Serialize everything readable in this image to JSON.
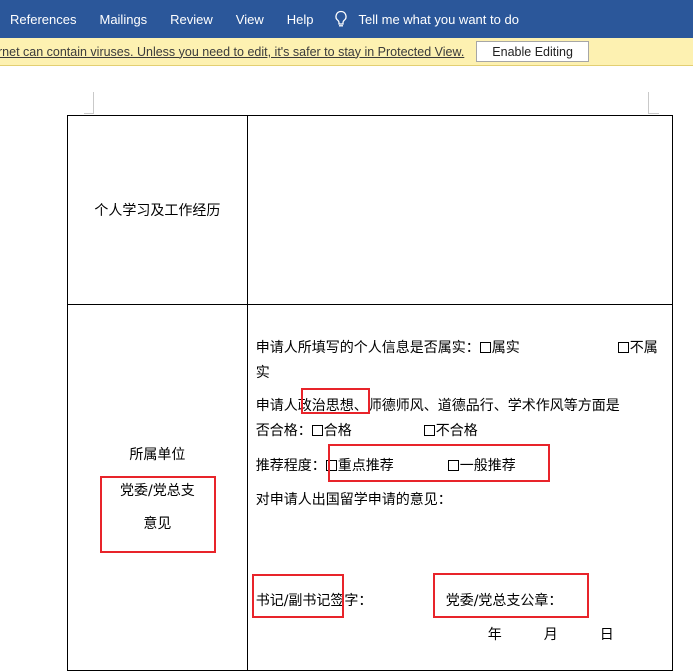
{
  "ribbon": {
    "tabs": [
      "References",
      "Mailings",
      "Review",
      "View",
      "Help"
    ],
    "tell_me": "Tell me what you want to do"
  },
  "protected_view": {
    "message": "rnet can contain viruses. Unless you need to edit, it's safer to stay in Protected View.",
    "button": "Enable Editing"
  },
  "form": {
    "row1_label": "个人学习及工作经历",
    "row2_label_line1": "所属单位",
    "row2_label_line2": "党委/党总支",
    "row2_label_line3": "意见",
    "info_question_a": "申请人所填写的个人信息是否属实：",
    "opt_true": "属实",
    "opt_false_a": "不属",
    "opt_false_b": "实",
    "eval_question_a": "申请人政治思想、师德师风、道德品行、学术作风等方面是",
    "eval_question_b": "否合格：",
    "opt_pass": "合格",
    "opt_fail": "不合格",
    "recommend_label": "推荐程度：",
    "opt_key": "重点推荐",
    "opt_general": "一般推荐",
    "opinion_label": "对申请人出国留学申请的意见：",
    "signature_label": "书记/副书记签字：",
    "seal_label": "党委/党总支公章：",
    "year": "年",
    "month": "月",
    "day": "日"
  },
  "colors": {
    "ribbon_bg": "#2b579a",
    "protected_bar_bg": "#fdf1b1",
    "highlight": "#e8242a"
  }
}
